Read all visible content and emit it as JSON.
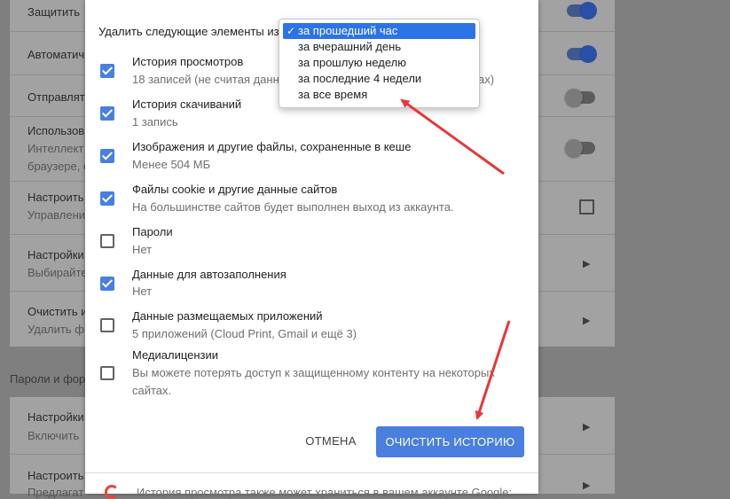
{
  "background": {
    "rows": [
      {
        "title": "Защитить",
        "subtitle": "",
        "toggle": "on"
      },
      {
        "title": "Автоматич",
        "subtitle": "",
        "toggle": "on"
      },
      {
        "title": "Отправлят",
        "subtitle": "",
        "toggle": "off"
      },
      {
        "title": "Использов",
        "subtitle": "Интеллект",
        "subtitle2": "браузере, с",
        "toggle": "off"
      },
      {
        "title": "Настроить",
        "subtitle": "Управлени"
      },
      {
        "title": "Настройки",
        "subtitle": "Выбирайте"
      },
      {
        "title": "Очистить и",
        "subtitle": "Удалить ф"
      }
    ],
    "section_title": "Пароли и фор",
    "section_rows": [
      {
        "title": "Настройки",
        "subtitle": "Включить"
      },
      {
        "title": "Настроить",
        "subtitle": "Предлагат"
      }
    ]
  },
  "dialog": {
    "range_label": "Удалить следующие элементы из",
    "dropdown": {
      "options": [
        "за прошедший час",
        "за вчерашний день",
        "за прошлую неделю",
        "за последние 4 недели",
        "за все время"
      ],
      "selected_index": 0,
      "check_glyph": "✓"
    },
    "items": [
      {
        "title": "История просмотров",
        "subtitle": "18 записей (не считая данн",
        "subtitle_tail": "ах)",
        "checked": true
      },
      {
        "title": "История скачиваний",
        "subtitle": "1 запись",
        "checked": true
      },
      {
        "title": "Изображения и другие файлы, сохраненные в кеше",
        "subtitle": "Менее 504 МБ",
        "checked": true
      },
      {
        "title": "Файлы cookie и другие данные сайтов",
        "subtitle": "На большинстве сайтов будет выполнен выход из аккаунта.",
        "checked": true
      },
      {
        "title": "Пароли",
        "subtitle": "Нет",
        "checked": false
      },
      {
        "title": "Данные для автозаполнения",
        "subtitle": "Нет",
        "checked": true
      },
      {
        "title": "Данные размещаемых приложений",
        "subtitle": "5 приложений (Cloud Print, Gmail и ещё 3)",
        "checked": false
      },
      {
        "title": "Медиалицензии",
        "subtitle": "Вы можете потерять доступ к защищенному контенту на некоторых сайтах.",
        "checked": false
      }
    ],
    "cancel_label": "ОТМЕНА",
    "clear_label": "ОЧИСТИТЬ ИСТОРИЮ",
    "footer_text": "История просмотра также может храниться в вашем аккаунте Google:"
  },
  "colors": {
    "accent": "#4a7fe0",
    "annotation_arrow": "#e5383b"
  }
}
